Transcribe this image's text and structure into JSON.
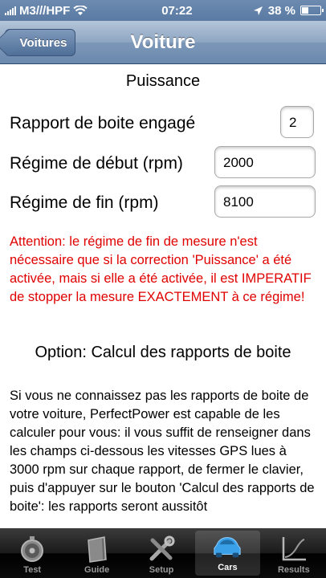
{
  "status": {
    "carrier": "M3///HPF",
    "time": "07:22",
    "battery": "38 %",
    "battery_level": 0.38
  },
  "nav": {
    "back_label": "Voitures",
    "title": "Voiture"
  },
  "content": {
    "section_title": "Puissance",
    "fields": [
      {
        "label": "Rapport de boite engagé",
        "value": "2"
      },
      {
        "label": "Régime de début (rpm)",
        "value": "2000"
      },
      {
        "label": "Régime de fin (rpm)",
        "value": "8100"
      }
    ],
    "warning": "Attention: le régime de fin de mesure n'est nécessaire que si la correction 'Puissance' a été activée, mais si elle a été activée, il est IMPERATIF de stopper la mesure EXACTEMENT à ce régime!",
    "option_title": "Option: Calcul des rapports de boite",
    "paragraph": "Si vous ne connaissez pas les rapports de boite de votre voiture, PerfectPower est capable de les calculer pour vous: il vous suffit de renseigner dans les champs ci-dessous les vitesses GPS lues à 3000 rpm sur chaque rapport, de fermer le clavier, puis d'appuyer sur le bouton 'Calcul des rapports de boite': les rapports seront aussitôt"
  },
  "tabs": [
    {
      "label": "Test",
      "icon": "stopwatch-icon"
    },
    {
      "label": "Guide",
      "icon": "book-icon"
    },
    {
      "label": "Setup",
      "icon": "tools-icon"
    },
    {
      "label": "Cars",
      "icon": "car-icon",
      "active": true
    },
    {
      "label": "Results",
      "icon": "graph-icon"
    }
  ],
  "colors": {
    "nav": "#6b89ae",
    "warning": "#e00000",
    "tab_active_icon": "#3aa0e8"
  }
}
